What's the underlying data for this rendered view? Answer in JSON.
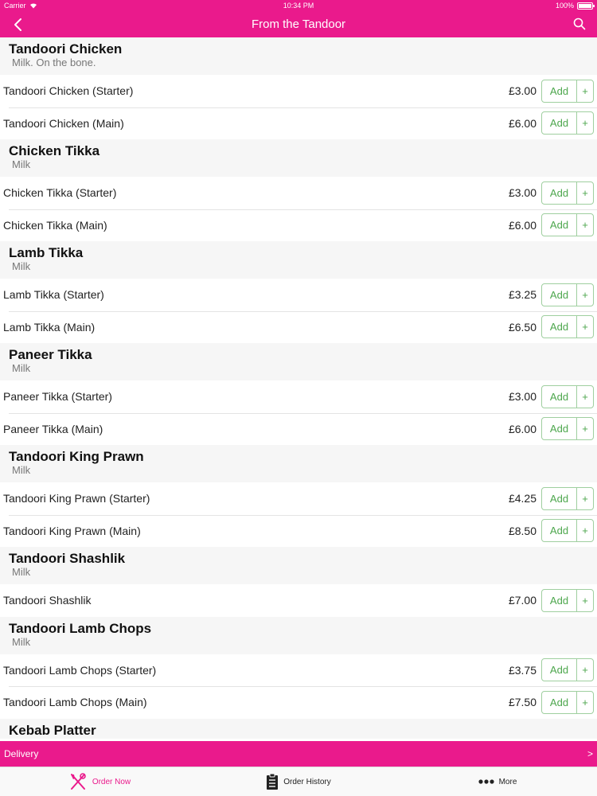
{
  "status_bar": {
    "carrier": "Carrier",
    "time": "10:34 PM",
    "battery": "100%"
  },
  "nav": {
    "title": "From the Tandoor"
  },
  "sections": [
    {
      "title": "Tandoori Chicken",
      "subtitle": "Milk. On the bone.",
      "items": [
        {
          "name": "Tandoori Chicken (Starter)",
          "price": "£3.00"
        },
        {
          "name": "Tandoori Chicken (Main)",
          "price": "£6.00"
        }
      ]
    },
    {
      "title": "Chicken Tikka",
      "subtitle": "Milk",
      "items": [
        {
          "name": "Chicken Tikka (Starter)",
          "price": "£3.00"
        },
        {
          "name": "Chicken Tikka (Main)",
          "price": "£6.00"
        }
      ]
    },
    {
      "title": "Lamb Tikka",
      "subtitle": "Milk",
      "items": [
        {
          "name": "Lamb Tikka (Starter)",
          "price": "£3.25"
        },
        {
          "name": "Lamb Tikka (Main)",
          "price": "£6.50"
        }
      ]
    },
    {
      "title": "Paneer Tikka",
      "subtitle": "Milk",
      "items": [
        {
          "name": "Paneer Tikka (Starter)",
          "price": "£3.00"
        },
        {
          "name": "Paneer Tikka (Main)",
          "price": "£6.00"
        }
      ]
    },
    {
      "title": "Tandoori King Prawn",
      "subtitle": "Milk",
      "items": [
        {
          "name": "Tandoori King Prawn (Starter)",
          "price": "£4.25"
        },
        {
          "name": "Tandoori King Prawn (Main)",
          "price": "£8.50"
        }
      ]
    },
    {
      "title": "Tandoori Shashlik",
      "subtitle": "Milk",
      "items": [
        {
          "name": "Tandoori Shashlik",
          "price": "£7.00"
        }
      ]
    },
    {
      "title": "Tandoori Lamb Chops",
      "subtitle": "Milk",
      "items": [
        {
          "name": "Tandoori Lamb Chops (Starter)",
          "price": "£3.75"
        },
        {
          "name": "Tandoori Lamb Chops (Main)",
          "price": "£7.50"
        }
      ]
    },
    {
      "title": "Kebab Platter",
      "subtitle": "",
      "items": []
    }
  ],
  "add_button": {
    "label": "Add",
    "plus": "+"
  },
  "delivery_bar": {
    "label": "Delivery",
    "chevron": ">"
  },
  "tabs": [
    {
      "label": "Order Now",
      "icon": "fork-knife-icon",
      "active": true
    },
    {
      "label": "Order History",
      "icon": "clipboard-icon",
      "active": false
    },
    {
      "label": "More",
      "icon": "more-dots-icon",
      "active": false
    }
  ],
  "colors": {
    "brand": "#ea1a8c",
    "add_green": "#4ca64c"
  }
}
